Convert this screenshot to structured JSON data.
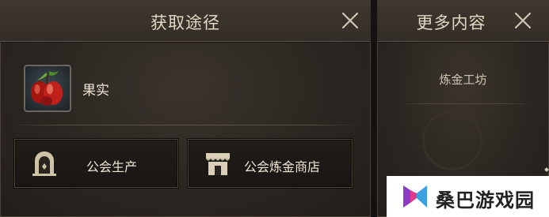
{
  "main_panel": {
    "title": "获取途径",
    "item": {
      "name": "果实",
      "icon": "red-berries-icon"
    },
    "sources": [
      {
        "label": "公会生产",
        "icon": "guild-gate-icon"
      },
      {
        "label": "公会炼金商店",
        "icon": "shop-awning-icon"
      }
    ],
    "close_icon": "close-icon"
  },
  "side_panel": {
    "title": "更多内容",
    "items": [
      "炼金工坊"
    ],
    "close_icon": "close-icon"
  },
  "watermark": {
    "text": "桑巴游戏园",
    "logo": "sangba-logo"
  },
  "colors": {
    "panel_bg": "#2b2621",
    "header_text": "#e2d7c3",
    "button_bg": "#1c1916",
    "button_border": "#4d443a",
    "berry_red": "#c0201a"
  }
}
